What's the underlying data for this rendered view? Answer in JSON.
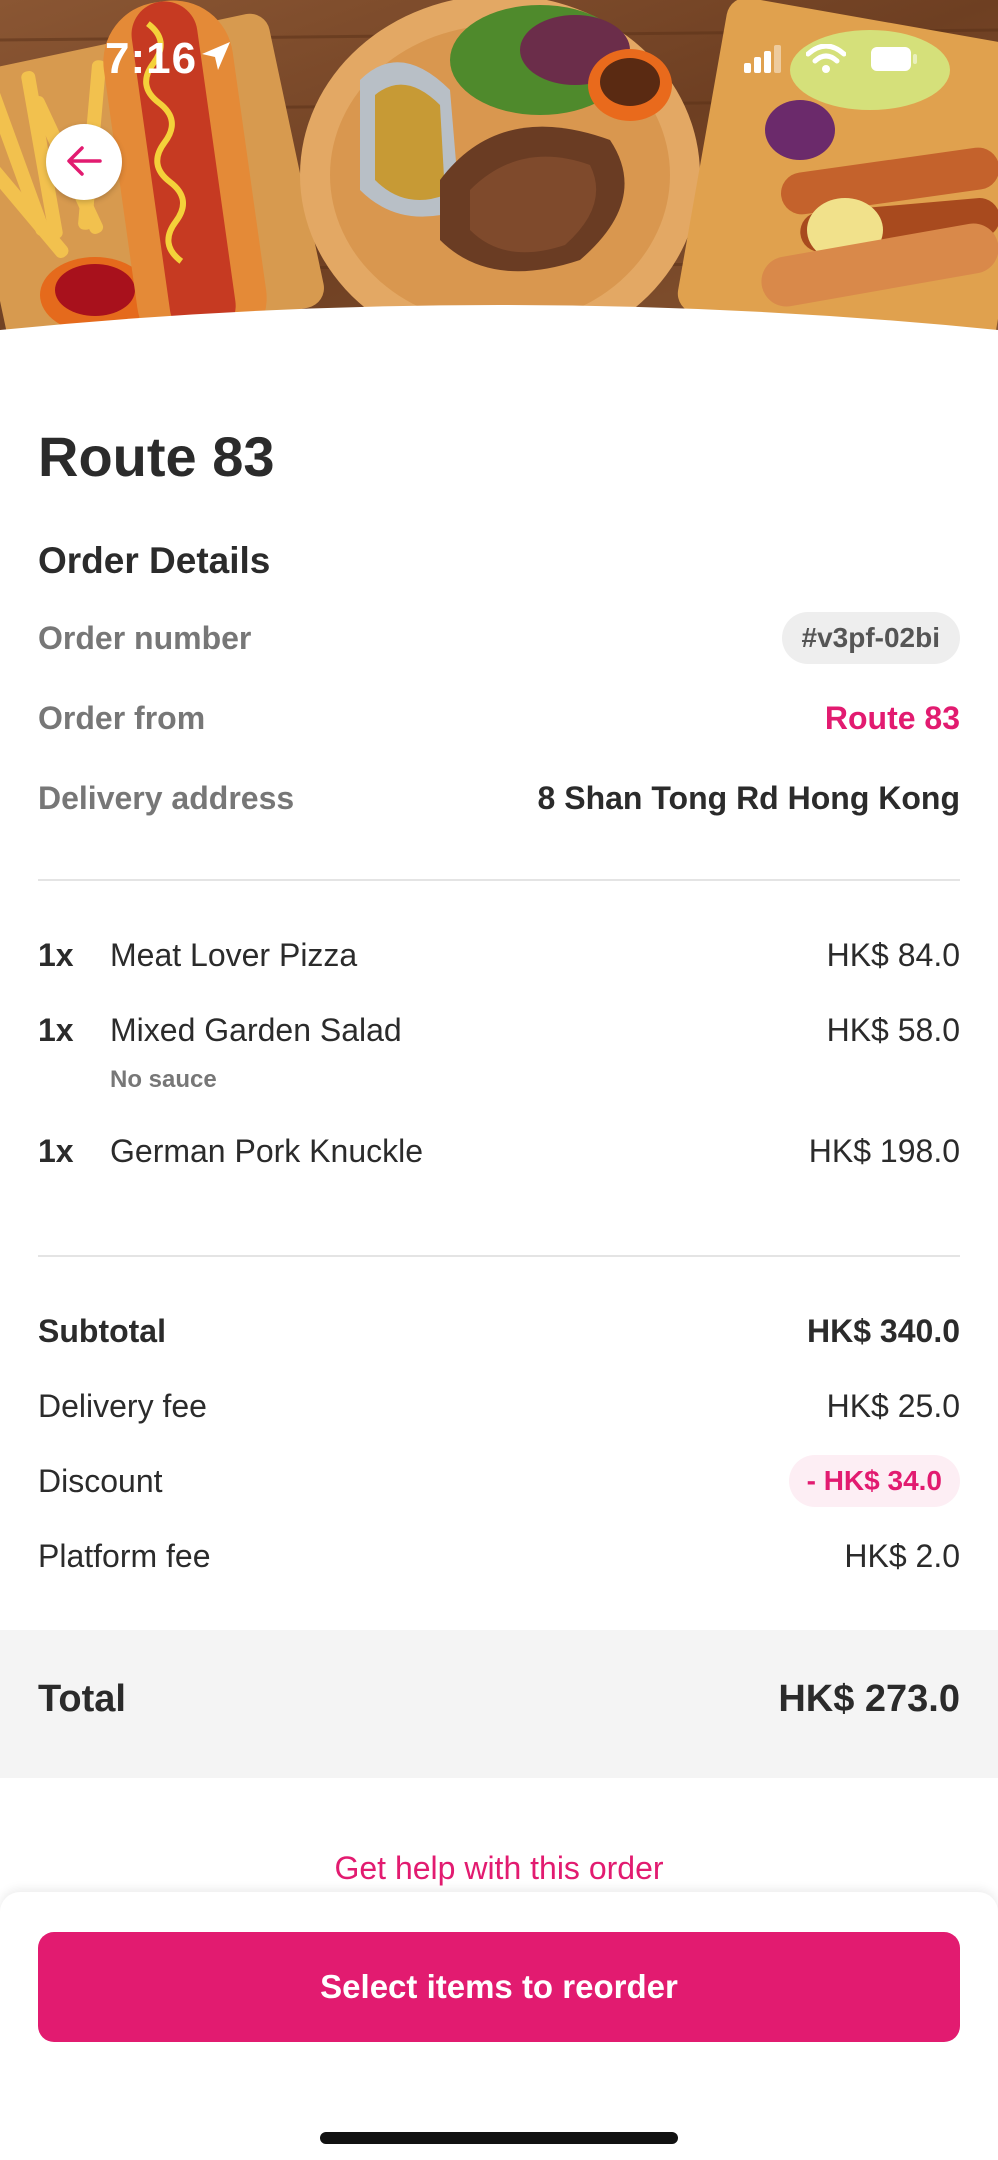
{
  "status_bar": {
    "time": "7:16",
    "icons": [
      "location-arrow-icon",
      "signal-icon",
      "wifi-icon",
      "battery-icon"
    ]
  },
  "header": {
    "image_icon": "food-banner-image",
    "back_icon": "arrow-left-icon"
  },
  "restaurant": {
    "name": "Route 83"
  },
  "order_details": {
    "section_title": "Order Details",
    "order_number_label": "Order number",
    "order_number_value": "#v3pf-02bi",
    "order_from_label": "Order from",
    "order_from_value": "Route 83",
    "delivery_address_label": "Delivery address",
    "delivery_address_value": "8 Shan Tong Rd Hong Kong"
  },
  "items": [
    {
      "qty": "1x",
      "name": "Meat Lover Pizza",
      "price": "HK$ 84.0",
      "note": ""
    },
    {
      "qty": "1x",
      "name": "Mixed Garden Salad",
      "price": "HK$ 58.0",
      "note": "No sauce"
    },
    {
      "qty": "1x",
      "name": "German Pork Knuckle",
      "price": "HK$ 198.0",
      "note": ""
    }
  ],
  "summary": {
    "subtotal_label": "Subtotal",
    "subtotal_value": "HK$ 340.0",
    "delivery_fee_label": "Delivery fee",
    "delivery_fee_value": "HK$ 25.0",
    "discount_label": "Discount",
    "discount_value": "- HK$ 34.0",
    "platform_fee_label": "Platform fee",
    "platform_fee_value": "HK$ 2.0"
  },
  "total": {
    "label": "Total",
    "value": "HK$ 273.0"
  },
  "help_link": "Get help with this order",
  "reorder_button": "Select items to reorder",
  "colors": {
    "accent": "#e21b70",
    "text": "#2b2b2b",
    "muted": "#777777",
    "band": "#f4f4f4"
  }
}
